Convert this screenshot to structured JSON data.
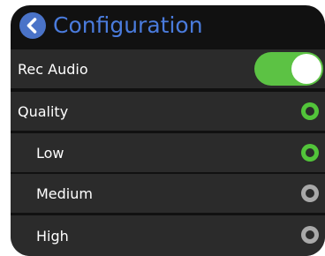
{
  "header": {
    "title": "Configuration",
    "back_icon": "chevron-left-icon"
  },
  "rec_audio": {
    "label": "Rec Audio",
    "toggle_on": true
  },
  "quality": {
    "label": "Quality",
    "selected": true
  },
  "options": [
    {
      "label": "Low",
      "selected": true
    },
    {
      "label": "Medium",
      "selected": false
    },
    {
      "label": "High",
      "selected": false
    }
  ],
  "colors": {
    "accent_blue": "#4a7bdc",
    "toggle_green": "#5cc244",
    "radio_on": "#52c43a",
    "radio_off": "#a9a9a9",
    "row_bg": "#2b2b2b",
    "screen_bg": "#111111"
  }
}
